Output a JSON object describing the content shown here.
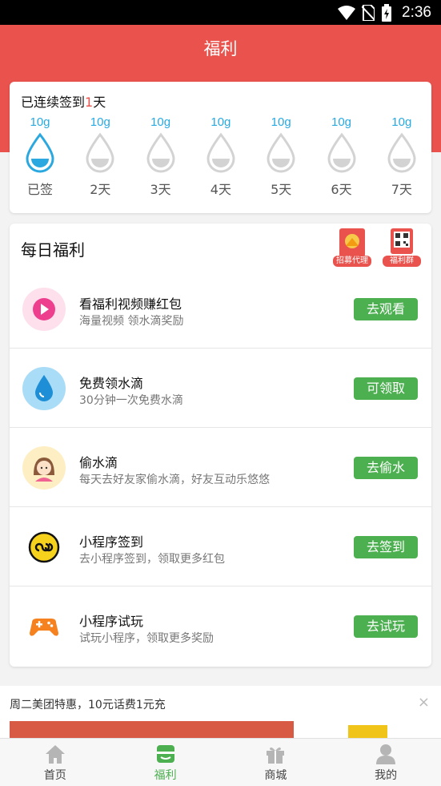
{
  "status_bar": {
    "time": "2:36"
  },
  "header": {
    "title": "福利"
  },
  "signin": {
    "prefix": "已连续签到",
    "days": "1",
    "suffix": "天",
    "items": [
      {
        "amount": "10g",
        "label": "已签",
        "done": true
      },
      {
        "amount": "10g",
        "label": "2天",
        "done": false
      },
      {
        "amount": "10g",
        "label": "3天",
        "done": false
      },
      {
        "amount": "10g",
        "label": "4天",
        "done": false
      },
      {
        "amount": "10g",
        "label": "5天",
        "done": false
      },
      {
        "amount": "10g",
        "label": "6天",
        "done": false
      },
      {
        "amount": "10g",
        "label": "7天",
        "done": false
      }
    ]
  },
  "daily": {
    "title": "每日福利",
    "badges": [
      {
        "label": "招募代理"
      },
      {
        "label": "福利群"
      }
    ],
    "tasks": [
      {
        "title": "看福利视频赚红包",
        "desc": "海量视频 领水滴奖励",
        "button": "去观看",
        "icon": "play-icon"
      },
      {
        "title": "免费领水滴",
        "desc": "30分钟一次免费水滴",
        "button": "可领取",
        "icon": "water-drop-icon"
      },
      {
        "title": "偷水滴",
        "desc": "每天去好友家偷水滴，好友互动乐悠悠",
        "button": "去偷水",
        "icon": "girl-avatar-icon"
      },
      {
        "title": "小程序签到",
        "desc": "去小程序签到，领取更多红包",
        "button": "去签到",
        "icon": "mini-program-icon"
      },
      {
        "title": "小程序试玩",
        "desc": "试玩小程序，领取更多奖励",
        "button": "去试玩",
        "icon": "gamepad-icon"
      }
    ]
  },
  "promo": {
    "text": "周二美团特惠，10元话费1元充",
    "close": "×"
  },
  "tabs": [
    {
      "label": "首页",
      "icon": "home-icon"
    },
    {
      "label": "福利",
      "icon": "welfare-icon",
      "active": true
    },
    {
      "label": "商城",
      "icon": "gift-icon"
    },
    {
      "label": "我的",
      "icon": "user-icon"
    }
  ],
  "colors": {
    "header": "#e9524d",
    "accent_green": "#4caf50",
    "drop_blue": "#29a9e0"
  }
}
